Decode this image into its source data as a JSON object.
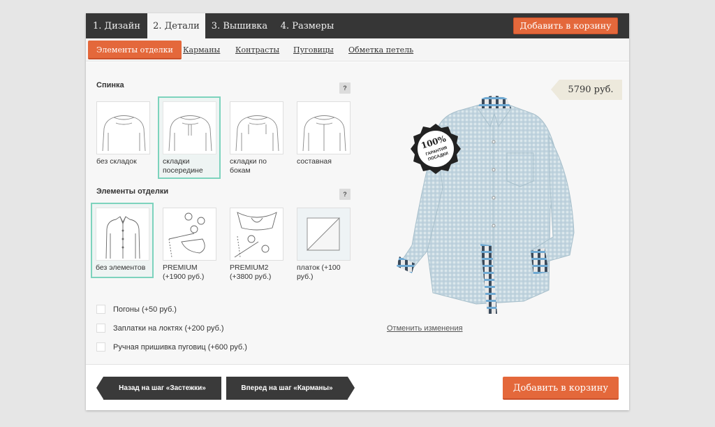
{
  "steps": [
    {
      "label": "1. Дизайн"
    },
    {
      "label": "2. Детали"
    },
    {
      "label": "3. Вышивка"
    },
    {
      "label": "4. Размеры"
    }
  ],
  "cart_top_label": "Добавить в корзину",
  "subtabs": [
    {
      "label": "Элементы отделки"
    },
    {
      "label": "Карманы"
    },
    {
      "label": "Контрасты"
    },
    {
      "label": "Пуговицы"
    },
    {
      "label": "Обметка петель"
    }
  ],
  "back_section": {
    "title": "Спинка",
    "help": "?",
    "options": [
      {
        "label": "без складок"
      },
      {
        "label": "складки посередине",
        "selected": true
      },
      {
        "label": "складки по бокам"
      },
      {
        "label": "составная"
      }
    ]
  },
  "trim_section": {
    "title": "Элементы отделки",
    "help": "?",
    "options": [
      {
        "label": "без элементов",
        "selected": true
      },
      {
        "label": "PREMIUM (+1900 руб.)"
      },
      {
        "label": "PREMIUM2 (+3800 руб.)"
      },
      {
        "label": "платок (+100 руб.)"
      }
    ]
  },
  "checkboxes": [
    {
      "label": "Погоны (+50 руб.)",
      "checked": false
    },
    {
      "label": "Заплатки на локтях (+200 руб.)",
      "checked": false
    },
    {
      "label": "Ручная пришивка пуговиц (+600 руб.)",
      "checked": false
    }
  ],
  "preview": {
    "price": "5790 руб.",
    "badge_big": "100%",
    "badge_line1": "ГАРАНТИЯ",
    "badge_line2": "ПОСАДКИ",
    "reset_label": "Отменить изменения"
  },
  "footer": {
    "back_label": "Назад на шаг «Застежки»",
    "forward_label": "Вперед на шаг «Карманы»",
    "cart_label": "Добавить в корзину"
  },
  "colors": {
    "accent": "#e4683b",
    "dark": "#363636",
    "selected_border": "#7dd3bd",
    "shirt": "#bcd2dc"
  },
  "icons": [
    "shirt-back-icon",
    "shirt-front-icon",
    "buttons-sewing-icon",
    "collar-sewing-icon",
    "pocket-square-icon",
    "guarantee-badge-icon"
  ]
}
